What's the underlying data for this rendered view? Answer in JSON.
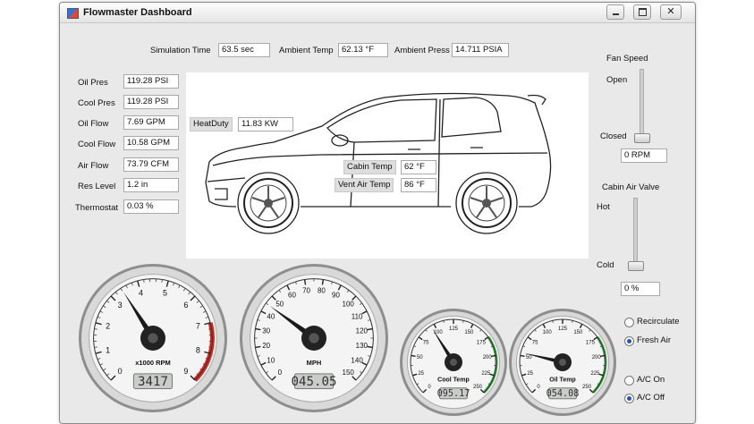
{
  "window": {
    "title": "Flowmaster Dashboard"
  },
  "top": {
    "sim_time_label": "Simulation Time",
    "sim_time_value": "63.5 sec",
    "ambient_temp_label": "Ambient Temp",
    "ambient_temp_value": "62.13 °F",
    "ambient_press_label": "Ambient Press",
    "ambient_press_value": "14.711 PSIA"
  },
  "left": [
    {
      "label": "Oil Pres",
      "value": "119.28 PSI"
    },
    {
      "label": "Cool Pres",
      "value": "119.28 PSI"
    },
    {
      "label": "Oil Flow",
      "value": "7.69 GPM"
    },
    {
      "label": "Cool Flow",
      "value": "10.58 GPM"
    },
    {
      "label": "Air Flow",
      "value": "73.79 CFM"
    },
    {
      "label": "Res Level",
      "value": "1.2 in"
    },
    {
      "label": "Thermostat",
      "value": "0.03 %"
    }
  ],
  "car": {
    "heat_duty_label": "HeatDuty",
    "heat_duty_value": "11.83 KW",
    "cabin_temp_label": "Cabin Temp",
    "cabin_temp_value": "62 °F",
    "vent_air_label": "Vent Air Temp",
    "vent_air_value": "86 °F"
  },
  "fan": {
    "title": "Fan Speed",
    "open_label": "Open",
    "closed_label": "Closed",
    "value": "0 RPM",
    "level": 0
  },
  "valve": {
    "title": "Cabin Air Valve",
    "hot_label": "Hot",
    "cold_label": "Cold",
    "value": "0 %",
    "level": 0
  },
  "air_mode": {
    "options": [
      "Recirculate",
      "Fresh Air"
    ],
    "selected": 1
  },
  "ac": {
    "options": [
      "A/C On",
      "A/C Off"
    ],
    "selected": 1
  },
  "gauges": {
    "rpm": {
      "label": "x1000 RPM",
      "ticks": [
        "0",
        "1",
        "2",
        "3",
        "4",
        "5",
        "6",
        "7",
        "8",
        "9"
      ],
      "readout": "3417",
      "value": 3.417,
      "min": 0,
      "max": 9
    },
    "mph": {
      "label": "MPH",
      "ticks": [
        "0",
        "10",
        "20",
        "30",
        "40",
        "50",
        "60",
        "70",
        "80",
        "90",
        "100",
        "110",
        "120",
        "130",
        "140",
        "150"
      ],
      "readout": "045.05",
      "value": 45.05,
      "min": 0,
      "max": 150
    },
    "cool": {
      "label": "Cool Temp",
      "ticks": [
        "0",
        "25",
        "50",
        "75",
        "100",
        "125",
        "150",
        "175",
        "200",
        "225",
        "250"
      ],
      "readout": "095.17",
      "value": 95.17,
      "min": 0,
      "max": 250
    },
    "oil": {
      "label": "Oil Temp",
      "ticks": [
        "0",
        "25",
        "50",
        "75",
        "100",
        "125",
        "150",
        "175",
        "200",
        "225",
        "250"
      ],
      "readout": "054.08",
      "value": 54.08,
      "min": 0,
      "max": 250
    }
  },
  "colors": {
    "redline": "#d9261c",
    "greenzone": "#3aa845",
    "lcd_bg": "#c9ccc9"
  }
}
